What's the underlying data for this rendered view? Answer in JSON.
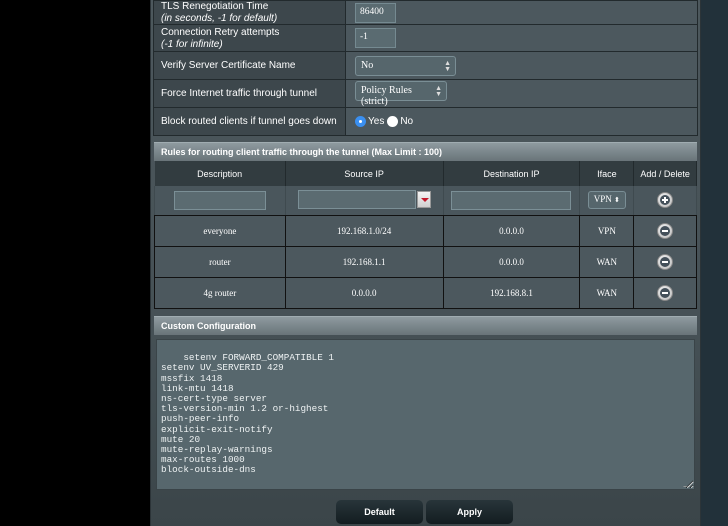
{
  "settings": {
    "rows": [
      {
        "label": "TLS Renegotiation Time",
        "sublabel": "(in seconds, -1 for default)",
        "type": "text",
        "value": "86400"
      },
      {
        "label": "Connection Retry attempts",
        "sublabel": "(-1 for infinite)",
        "type": "text",
        "value": "-1"
      },
      {
        "label": "Verify Server Certificate Name",
        "type": "select",
        "value": "No"
      },
      {
        "label": "Force Internet traffic through tunnel",
        "type": "select",
        "value": "Policy Rules (strict)"
      },
      {
        "label": "Block routed clients if tunnel goes down",
        "type": "radio",
        "options": [
          "Yes",
          "No"
        ],
        "selected": "Yes"
      }
    ]
  },
  "rules": {
    "title": "Rules for routing client traffic through the tunnel (Max Limit : 100)",
    "columns": [
      "Description",
      "Source IP",
      "Destination IP",
      "Iface",
      "Add / Delete"
    ],
    "new_row": {
      "description": "",
      "source_ip": "",
      "destination_ip": "",
      "iface": "VPN"
    },
    "rows": [
      {
        "description": "everyone",
        "source_ip": "192.168.1.0/24",
        "destination_ip": "0.0.0.0",
        "iface": "VPN"
      },
      {
        "description": "router",
        "source_ip": "192.168.1.1",
        "destination_ip": "0.0.0.0",
        "iface": "WAN"
      },
      {
        "description": "4g router",
        "source_ip": "0.0.0.0",
        "destination_ip": "192.168.8.1",
        "iface": "WAN"
      }
    ]
  },
  "custom_config": {
    "title": "Custom Configuration",
    "text": "setenv FORWARD_COMPATIBLE 1\nsetenv UV_SERVERID 429\nmssfix 1418\nlink-mtu 1418\nns-cert-type server\ntls-version-min 1.2 or-highest\npush-peer-info\nexplicit-exit-notify\nmute 20\nmute-replay-warnings\nmax-routes 1000\nblock-outside-dns"
  },
  "buttons": {
    "default_label": "Default",
    "apply_label": "Apply"
  },
  "colors": {
    "radio_selected": "#3a8ff0",
    "dropdown_arrow": "#c2182b"
  }
}
